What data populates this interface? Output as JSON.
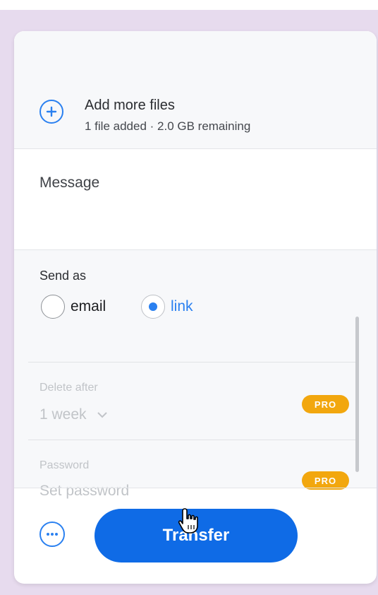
{
  "add_files": {
    "title": "Add more files",
    "status": "1 file added · 2.0 GB remaining",
    "icon": "plus-circle-icon"
  },
  "message": {
    "placeholder": "Message",
    "value": ""
  },
  "send_as": {
    "label": "Send as",
    "options": [
      {
        "label": "email",
        "selected": false
      },
      {
        "label": "link",
        "selected": true
      }
    ]
  },
  "delete_after": {
    "label": "Delete after",
    "value": "1 week",
    "badge": "PRO"
  },
  "password": {
    "label": "Password",
    "placeholder": "Set password",
    "badge": "PRO"
  },
  "actions": {
    "more_icon": "ellipsis-circle-icon",
    "transfer_label": "Transfer"
  },
  "colors": {
    "accent": "#2a80f0",
    "primary_button": "#0f6be6",
    "pro_badge": "#f2a70e",
    "backdrop": "#e7dbee"
  }
}
